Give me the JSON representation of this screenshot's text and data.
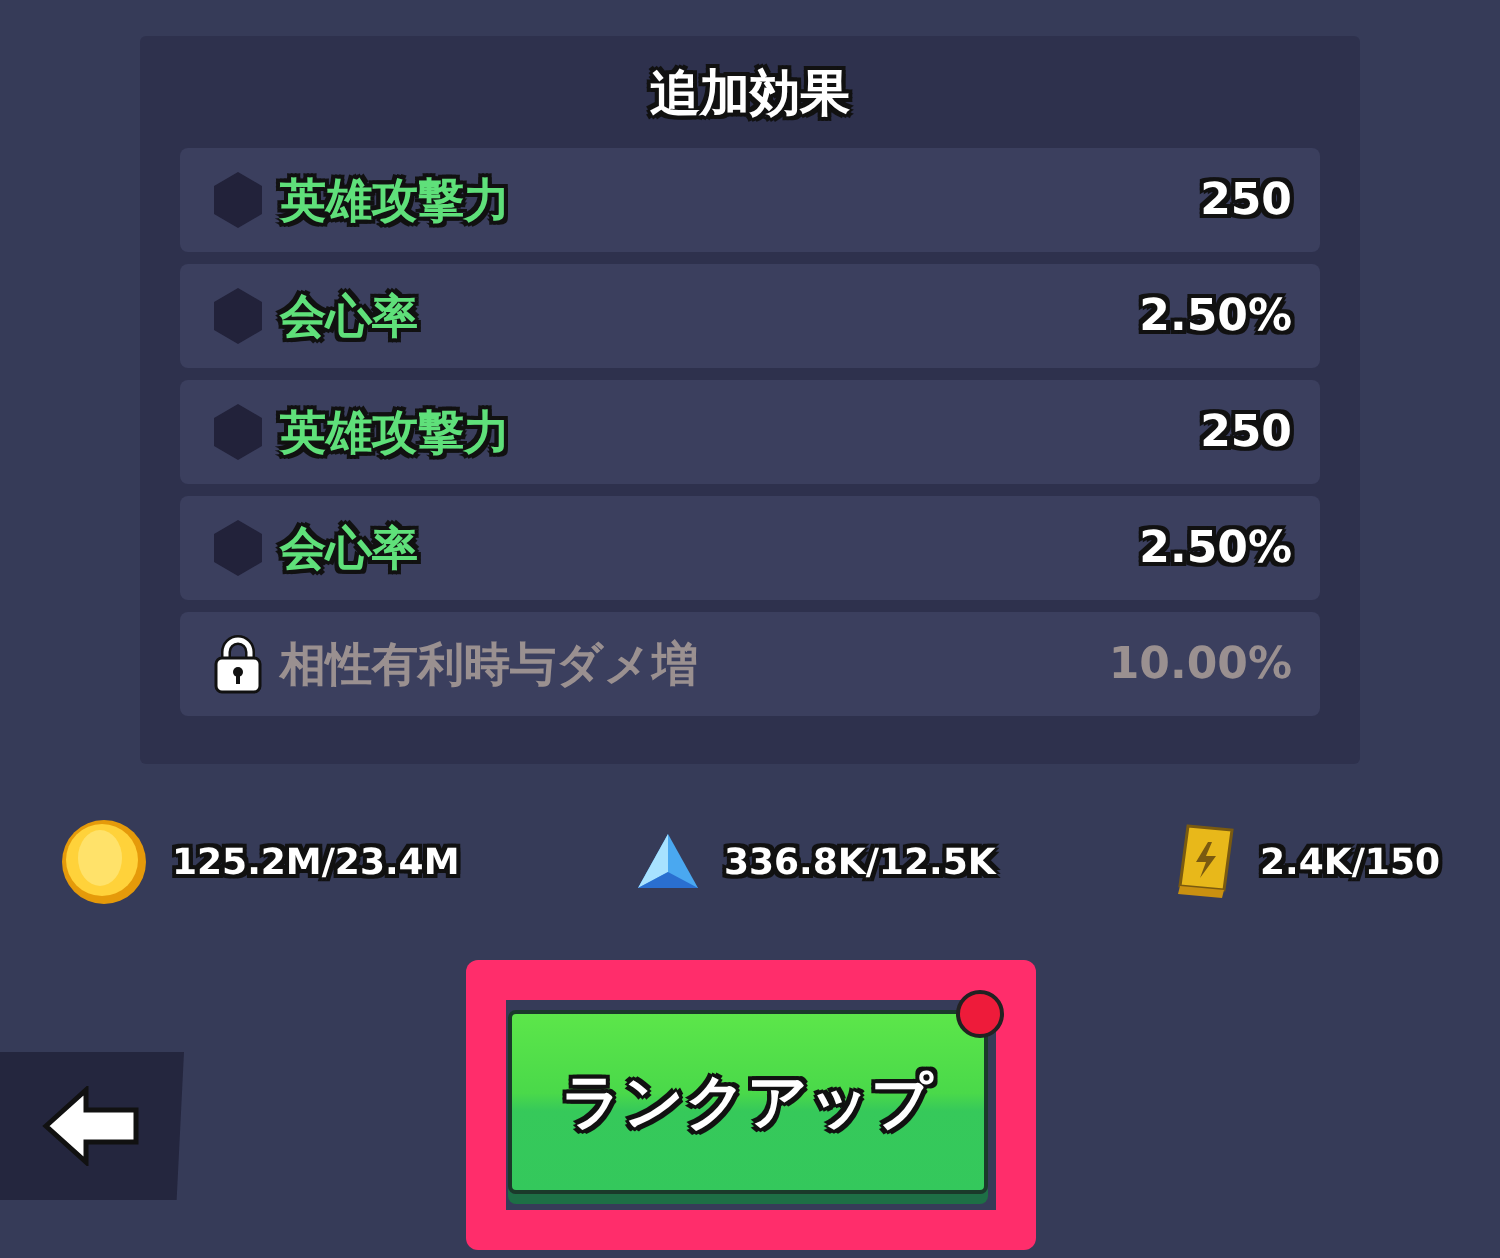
{
  "panel": {
    "title": "追加効果",
    "effects": [
      {
        "name": "英雄攻撃力",
        "value": "250",
        "locked": false
      },
      {
        "name": "会心率",
        "value": "2.50%",
        "locked": false
      },
      {
        "name": "英雄攻撃力",
        "value": "250",
        "locked": false
      },
      {
        "name": "会心率",
        "value": "2.50%",
        "locked": false
      },
      {
        "name": "相性有利時与ダメ増",
        "value": "10.00%",
        "locked": true
      }
    ]
  },
  "resources": [
    {
      "kind": "coin",
      "amount": "125.2M/23.4M"
    },
    {
      "kind": "crystal",
      "amount": "336.8K/12.5K"
    },
    {
      "kind": "book",
      "amount": "2.4K/150"
    }
  ],
  "rank_up_button": {
    "label": "ランクアップ",
    "notification": true,
    "highlighted": true
  }
}
